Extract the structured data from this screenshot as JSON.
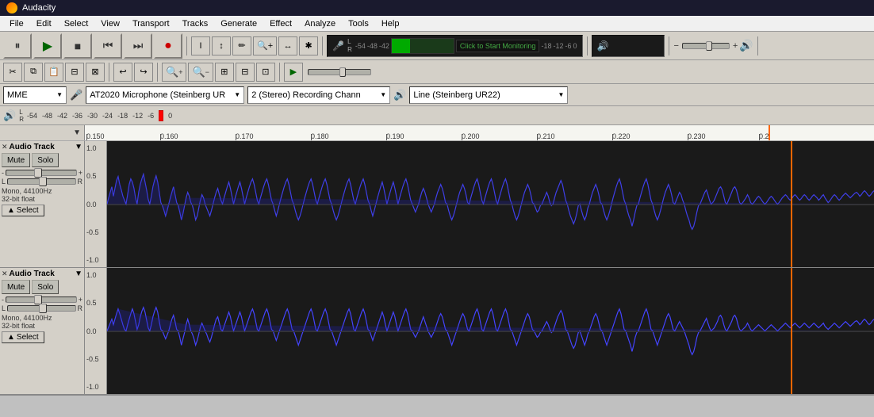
{
  "app": {
    "title": "Audacity",
    "icon": "audacity-icon"
  },
  "menu": {
    "items": [
      "File",
      "Edit",
      "Select",
      "View",
      "Transport",
      "Tracks",
      "Generate",
      "Effect",
      "Analyze",
      "Tools",
      "Help"
    ]
  },
  "transport": {
    "pause_label": "⏸",
    "play_label": "▶",
    "stop_label": "■",
    "skip_start_label": "⏮",
    "skip_end_label": "⏭",
    "record_label": "●"
  },
  "tools": {
    "selection": "I",
    "envelope": "↕",
    "draw": "✏",
    "zoom_in": "🔍",
    "zoom_out_sel": "↔",
    "multi": "✱"
  },
  "edit_toolbar": {
    "cut": "✂",
    "copy": "⧉",
    "paste": "📋",
    "trim": "⊟",
    "silence": "⊠",
    "undo": "↩",
    "redo": "↪",
    "zoom_in": "+",
    "zoom_out": "-",
    "zoom_sel": "⊞",
    "zoom_fit": "⊟",
    "zoom_custom": "⊡"
  },
  "meters": {
    "recording_label": "Click to Start Monitoring",
    "mic_icon": "mic-icon",
    "speaker_icon": "speaker-icon",
    "vu_scale": [
      "-54",
      "-48",
      "-42",
      "-18",
      "-12",
      "-6",
      "0"
    ],
    "vu_scale2": [
      "-54",
      "-48",
      "-42",
      "-18",
      "-12",
      "-6",
      "0"
    ],
    "L": "L",
    "R": "R"
  },
  "devices": {
    "host": "MME",
    "mic_input": "AT2020 Microphone (Steinberg UR",
    "channels": "2 (Stereo) Recording Chann",
    "output": "Line (Steinberg UR22)"
  },
  "ruler": {
    "ticks": [
      "0.150",
      "0.160",
      "0.170",
      "0.180",
      "0.190",
      "0.200",
      "0.210",
      "0.220",
      "0.230",
      "0.2"
    ]
  },
  "tracks": [
    {
      "id": "track1",
      "name": "Audio Track",
      "mute_label": "Mute",
      "solo_label": "Solo",
      "vol_min": "-",
      "vol_max": "+",
      "vol_thumb_pos": "40%",
      "pan_L": "L",
      "pan_R": "R",
      "pan_thumb_pos": "48%",
      "info_line1": "Mono, 44100Hz",
      "info_line2": "32-bit float",
      "select_label": "Select",
      "select_arrow": "▲",
      "y_labels": [
        "1.0",
        "0.5",
        "0.0",
        "-0.5",
        "-1.0"
      ]
    },
    {
      "id": "track2",
      "name": "Audio Track",
      "mute_label": "Mute",
      "solo_label": "Solo",
      "vol_min": "-",
      "vol_max": "+",
      "vol_thumb_pos": "40%",
      "pan_L": "L",
      "pan_R": "R",
      "pan_thumb_pos": "48%",
      "info_line1": "Mono, 44100Hz",
      "info_line2": "32-bit float",
      "select_label": "Select",
      "select_arrow": "▲",
      "y_labels": [
        "1.0",
        "0.5",
        "0.0",
        "-0.5",
        "-1.0"
      ]
    }
  ],
  "colors": {
    "waveform": "#4444ff",
    "waveform_bg": "#1a1a1a",
    "playhead": "#ff6600",
    "track_header_bg": "#d4d0c8",
    "toolbar_bg": "#d4d0c8"
  },
  "footer": {
    "status": ""
  }
}
